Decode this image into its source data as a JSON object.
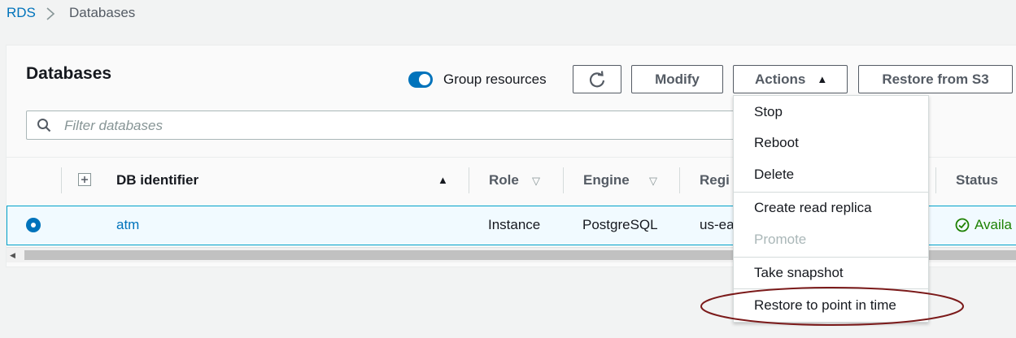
{
  "breadcrumb": {
    "root": "RDS",
    "current": "Databases"
  },
  "page": {
    "title": "Databases"
  },
  "toolbar": {
    "group_resources_label": "Group resources",
    "group_resources_on": true,
    "refresh_icon": "refresh-icon",
    "modify_label": "Modify",
    "actions_label": "Actions",
    "restore_s3_label": "Restore from S3"
  },
  "search": {
    "placeholder": "Filter databases",
    "value": ""
  },
  "table": {
    "columns": [
      "DB identifier",
      "Role",
      "Engine",
      "Regi",
      "Status"
    ],
    "rows": [
      {
        "selected": true,
        "identifier": "atm",
        "role": "Instance",
        "engine": "PostgreSQL",
        "region": "us-ea",
        "status": "Availa"
      }
    ]
  },
  "actions_menu": {
    "items": [
      {
        "label": "Stop",
        "enabled": true
      },
      {
        "label": "Reboot",
        "enabled": true
      },
      {
        "label": "Delete",
        "enabled": true
      },
      {
        "label": "Create read replica",
        "enabled": true
      },
      {
        "label": "Promote",
        "enabled": false
      },
      {
        "label": "Take snapshot",
        "enabled": true
      },
      {
        "label": "Restore to point in time",
        "enabled": true,
        "highlighted": true
      }
    ]
  },
  "colors": {
    "link": "#0073bb",
    "status_available": "#1d8102",
    "annotation": "#7b1a1a"
  }
}
